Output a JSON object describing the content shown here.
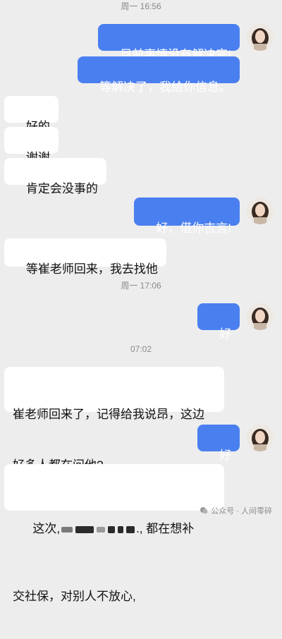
{
  "timestamps": {
    "t1": "周一 16:56",
    "t2": "周一 17:06",
    "t3": "07:02"
  },
  "messages": {
    "m1": "目前事情没有解决完!",
    "m2": "等解决了，我给你信息。",
    "m3": "好的",
    "m4": "谢谢",
    "m5": "肯定会没事的",
    "m6": "好，借你吉言!",
    "m7": "等崔老师回来，我去找他",
    "m8": "好",
    "m9_line1": "崔老师回来了，记得给我说昂，这边",
    "m9_line2": "好多人都在问他?",
    "m10": "好",
    "m11_prefix": "这次,",
    "m11_suffix": "., 都在想补",
    "m11_line2": "交社保，对别人不放心,"
  },
  "watermark": "公众号 · 人间零碎",
  "icons": {
    "avatar": "avatar-woman-icon",
    "wechat": "wechat-icon"
  },
  "colors": {
    "outgoing_bubble": "#4a7ff0",
    "incoming_bubble": "#ffffff",
    "background": "#ededed"
  }
}
